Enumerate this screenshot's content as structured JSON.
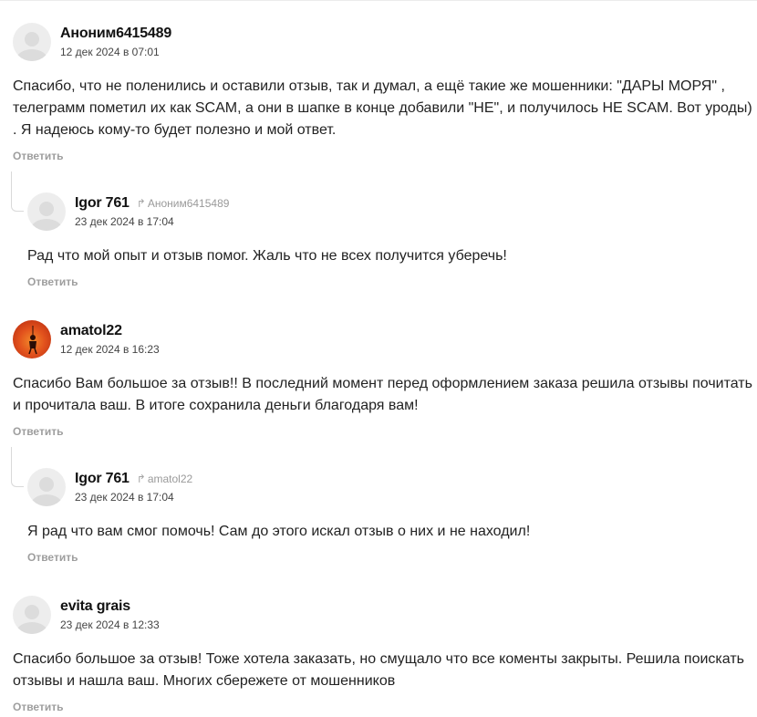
{
  "comments": [
    {
      "author": "Аноним6415489",
      "date": "12 дек 2024 в 07:01",
      "text": "Спасибо, что не поленились и оставили отзыв, так и думал, а ещё такие же мошенники: \"ДАРЫ МОРЯ\" , телеграмм пометил их как SCAM, а они в шапке в конце добавили \"НЕ\", и получилось НЕ SCAM. Вот уроды) . Я надеюсь кому-то будет полезно и мой ответ.",
      "answer_label": "Ответить"
    },
    {
      "author": "Igor 761",
      "reply_to": "Аноним6415489",
      "date": "23 дек 2024 в 17:04",
      "text": "Рад что мой опыт и отзыв помог. Жаль что не всех получится уберечь!",
      "answer_label": "Ответить"
    },
    {
      "author": "amatol22",
      "date": "12 дек 2024 в 16:23",
      "text": "Спасибо Вам большое за отзыв!! В последний момент перед оформлением заказа решила отзывы почитать и прочитала ваш. В итоге сохранила деньги благодаря вам!",
      "answer_label": "Ответить"
    },
    {
      "author": "Igor 761",
      "reply_to": "amatol22",
      "date": "23 дек 2024 в 17:04",
      "text": "Я рад что вам смог помочь! Сам до этого искал отзыв о них и не находил!",
      "answer_label": "Ответить"
    },
    {
      "author": "evita grais",
      "date": "23 дек 2024 в 12:33",
      "text": "Спасибо большое за отзыв! Тоже хотела заказать, но смущало что все коменты закрыты. Решила поискать отзывы и нашла ваш. Многих сбережете от мошенников",
      "answer_label": "Ответить"
    }
  ],
  "icons": {
    "avatar_default": "user-placeholder-icon",
    "reply": "reply-arrow-icon"
  },
  "colors": {
    "text": "#222222",
    "muted": "#9e9e9e",
    "avatar_bg": "#ededed"
  }
}
